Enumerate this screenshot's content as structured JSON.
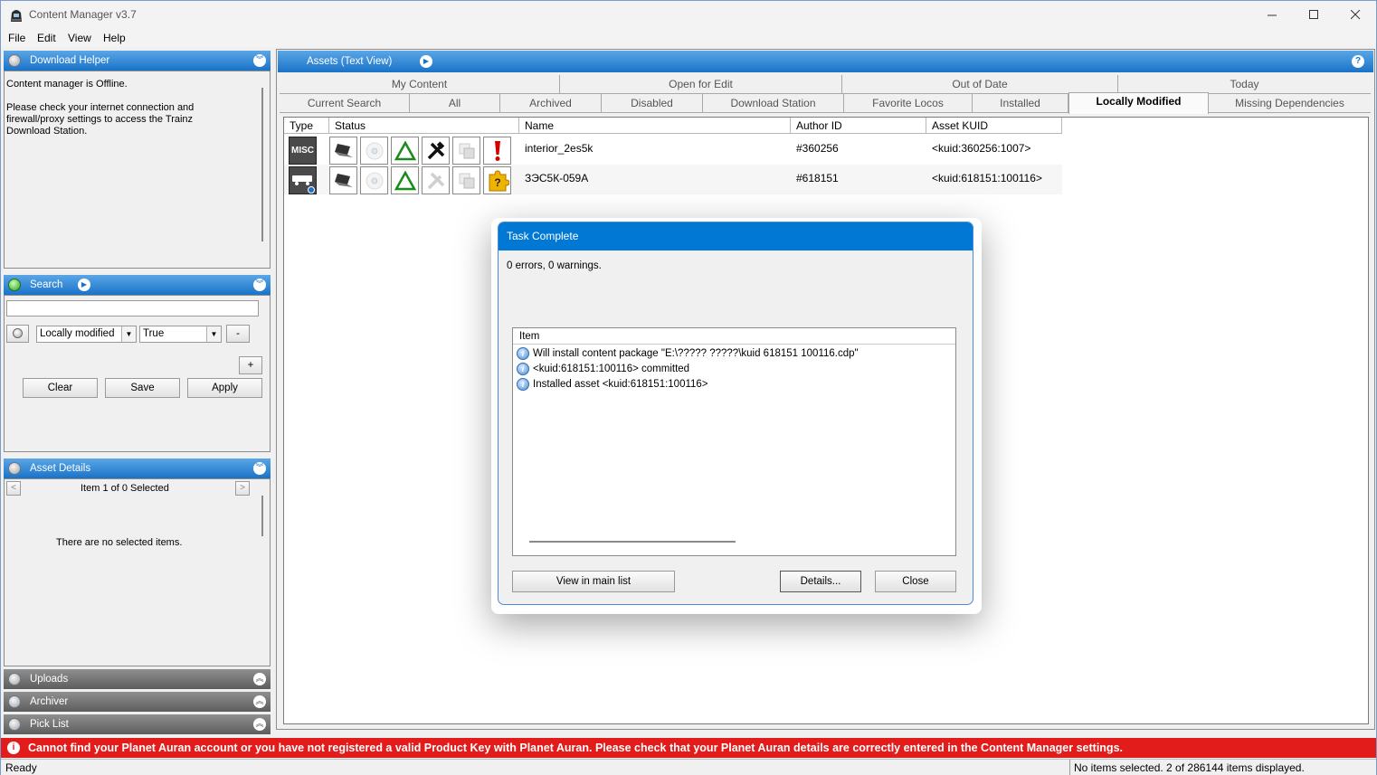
{
  "window": {
    "title": "Content Manager v3.7"
  },
  "menu": [
    "File",
    "Edit",
    "View",
    "Help"
  ],
  "download_helper": {
    "title": "Download Helper",
    "offline_text": "Content manager is Offline.",
    "message": "Please check your internet connection and firewall/proxy settings to access the Trainz Download Station."
  },
  "search": {
    "title": "Search",
    "input_value": "",
    "field_select": "Locally modified",
    "value_select": "True",
    "minus_label": "-",
    "plus_label": "+",
    "clear_label": "Clear",
    "save_label": "Save",
    "apply_label": "Apply"
  },
  "asset_details": {
    "title": "Asset Details",
    "prev_label": "<",
    "next_label": ">",
    "item_counter": "Item 1 of 0 Selected",
    "empty_text": "There are no selected items."
  },
  "collapsed_panels": [
    "Uploads",
    "Archiver",
    "Pick List"
  ],
  "assets": {
    "title": "Assets (Text View)",
    "help_label": "?",
    "tabs_row1": [
      "My Content",
      "Open for Edit",
      "Out of Date",
      "Today"
    ],
    "tabs_row2": [
      "Current Search",
      "All",
      "Archived",
      "Disabled",
      "Download Station",
      "Favorite Locos",
      "Installed",
      "Locally Modified",
      "Missing Dependencies"
    ],
    "active_tab": "Locally Modified",
    "columns": [
      "Type",
      "Status",
      "Name",
      "Author ID",
      "Asset KUID"
    ],
    "rows": [
      {
        "type_badge": "MISC",
        "name": "interior_2es5k",
        "author": "#360256",
        "kuid": "<kuid:360256:1007>"
      },
      {
        "type_badge": "",
        "name": "ЗЭС5К-059А",
        "author": "#618151",
        "kuid": "<kuid:618151:100116>"
      }
    ]
  },
  "dialog": {
    "title": "Task Complete",
    "summary": "0 errors, 0 warnings.",
    "list_header": "Item",
    "messages": [
      "Will install content package \"E:\\????? ?????\\kuid 618151 100116.cdp\"",
      "<kuid:618151:100116> committed",
      "Installed asset <kuid:618151:100116>"
    ],
    "view_button": "View in main list",
    "details_button": "Details...",
    "close_button": "Close"
  },
  "alert_text": "Cannot find your Planet Auran account or you have not registered a valid Product Key with Planet Auran. Please check that your Planet Auran details are correctly entered in the Content Manager settings.",
  "status": {
    "left": "Ready",
    "right": "No items selected. 2 of 286144 items displayed."
  },
  "colors": {
    "accent_blue": "#1a73c8",
    "dialog_title": "#0078d4",
    "alert_red": "#e21b1b",
    "green_icon": "#2ea01e"
  }
}
